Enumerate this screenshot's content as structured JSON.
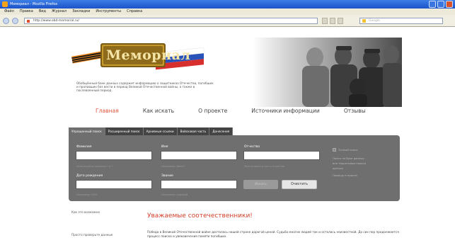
{
  "browser": {
    "window_title": "Мемориал - Mozilla Firefox",
    "menu": [
      "Файл",
      "Правка",
      "Вид",
      "Журнал",
      "Закладки",
      "Инструменты",
      "Справка"
    ],
    "address_value": "http://www.obd-memorial.ru/",
    "search_placeholder": "Google"
  },
  "site": {
    "logo_text": "Мемориал",
    "tagline": "Обобщённый банк данных содержит информацию о защитниках Отечества, погибших и пропавших без вести в период Великой Отечественной войны, а также в послевоенный период."
  },
  "nav": {
    "items": [
      {
        "label": "Главная",
        "active": true
      },
      {
        "label": "Как искать",
        "active": false
      },
      {
        "label": "О проекте",
        "active": false
      },
      {
        "label": "Источники информации",
        "active": false
      },
      {
        "label": "Отзывы",
        "active": false
      }
    ]
  },
  "search": {
    "tabs": [
      {
        "label": "Упрощенный поиск",
        "active": true
      },
      {
        "label": "Расширенный поиск",
        "active": false
      },
      {
        "label": "Архивные ссылки",
        "active": false
      },
      {
        "label": "Войсковая часть",
        "active": false
      },
      {
        "label": "Донесения",
        "active": false
      }
    ],
    "fields": {
      "lastname_label": "Фамилия",
      "firstname_label": "Имя",
      "patronymic_label": "Отчество",
      "birthdate_label": "Дата рождения",
      "rank_label": "Звание",
      "hint_1": "Используйте символы * и ?",
      "hint_2": "Например: Иван*",
      "hint_3": "Можно ввести часть отчества",
      "hint_4": "Например 1920",
      "hint_5": "Например: рядовой"
    },
    "submit_label": "Искать",
    "clear_label": "Очистить",
    "side_links": [
      "Точный поиск",
      "Поиск по базе данных",
      "вне территории поиска",
      "данных",
      "Помощь в поиске"
    ]
  },
  "content": {
    "left_links": [
      "Как это возможно",
      "Просто проверьте данные"
    ],
    "greeting": "Уважаемые соотечественники!",
    "body": "Победа в Великой Отечественной войне досталась нашей стране дорогой ценой. Судьба многих людей так и осталась неизвестной. До сих пор продолжается процесс поиска и увековечения памяти погибших."
  },
  "colors": {
    "accent_red": "#e2553c",
    "panel_bg": "#6f6f6f",
    "tab_bg": "#444444"
  }
}
